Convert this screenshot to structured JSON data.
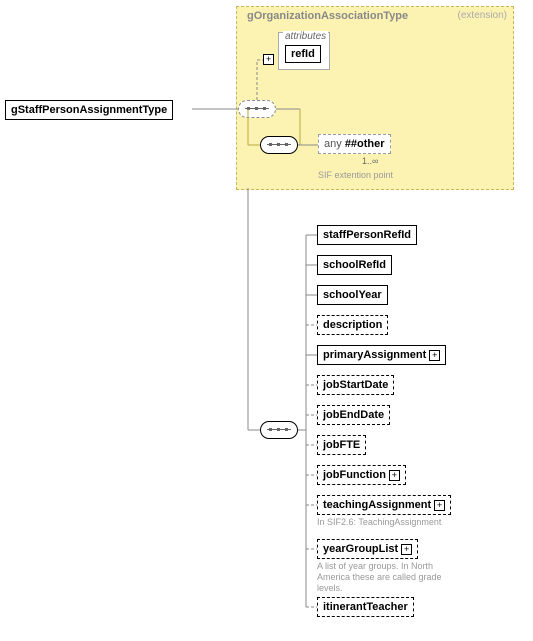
{
  "root": "gStaffPersonAssignmentType",
  "ext": {
    "title": "gOrganizationAssociationType",
    "kind": "(extension)"
  },
  "attr": {
    "label": "attributes",
    "item": "refId"
  },
  "any": {
    "prefix": "any",
    "ns": "##other",
    "card": "1..∞",
    "note": "SIF extention point"
  },
  "children": [
    {
      "name": "staffPersonRefId",
      "dashed": false,
      "plus": false
    },
    {
      "name": "schoolRefId",
      "dashed": false,
      "plus": false
    },
    {
      "name": "schoolYear",
      "dashed": false,
      "plus": false
    },
    {
      "name": "description",
      "dashed": true,
      "plus": false
    },
    {
      "name": "primaryAssignment",
      "dashed": false,
      "plus": true
    },
    {
      "name": "jobStartDate",
      "dashed": true,
      "plus": false
    },
    {
      "name": "jobEndDate",
      "dashed": true,
      "plus": false
    },
    {
      "name": "jobFTE",
      "dashed": true,
      "plus": false
    },
    {
      "name": "jobFunction",
      "dashed": true,
      "plus": true
    },
    {
      "name": "teachingAssignment",
      "dashed": true,
      "plus": true,
      "note": "In SIF2.6: TeachingAssignment"
    },
    {
      "name": "yearGroupList",
      "dashed": true,
      "plus": true,
      "note": "A list of year groups.  In North America these are called grade levels."
    },
    {
      "name": "itinerantTeacher",
      "dashed": true,
      "plus": false
    }
  ]
}
